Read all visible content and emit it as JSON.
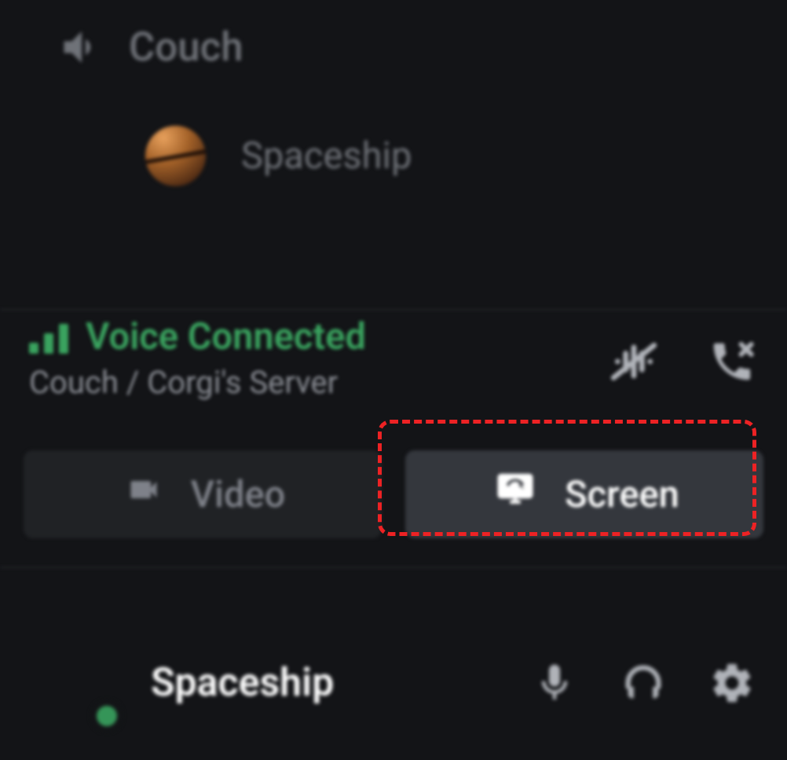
{
  "channel": {
    "name": "Couch"
  },
  "member": {
    "name": "Spaceship"
  },
  "connection": {
    "status_label": "Voice Connected",
    "path": "Couch / Corgi's Server"
  },
  "buttons": {
    "video_label": "Video",
    "screen_label": "Screen"
  },
  "user": {
    "name": "Spaceship"
  },
  "colors": {
    "accent_green": "#3aa35f",
    "highlight_red": "#ed2224",
    "background": "#131417"
  }
}
